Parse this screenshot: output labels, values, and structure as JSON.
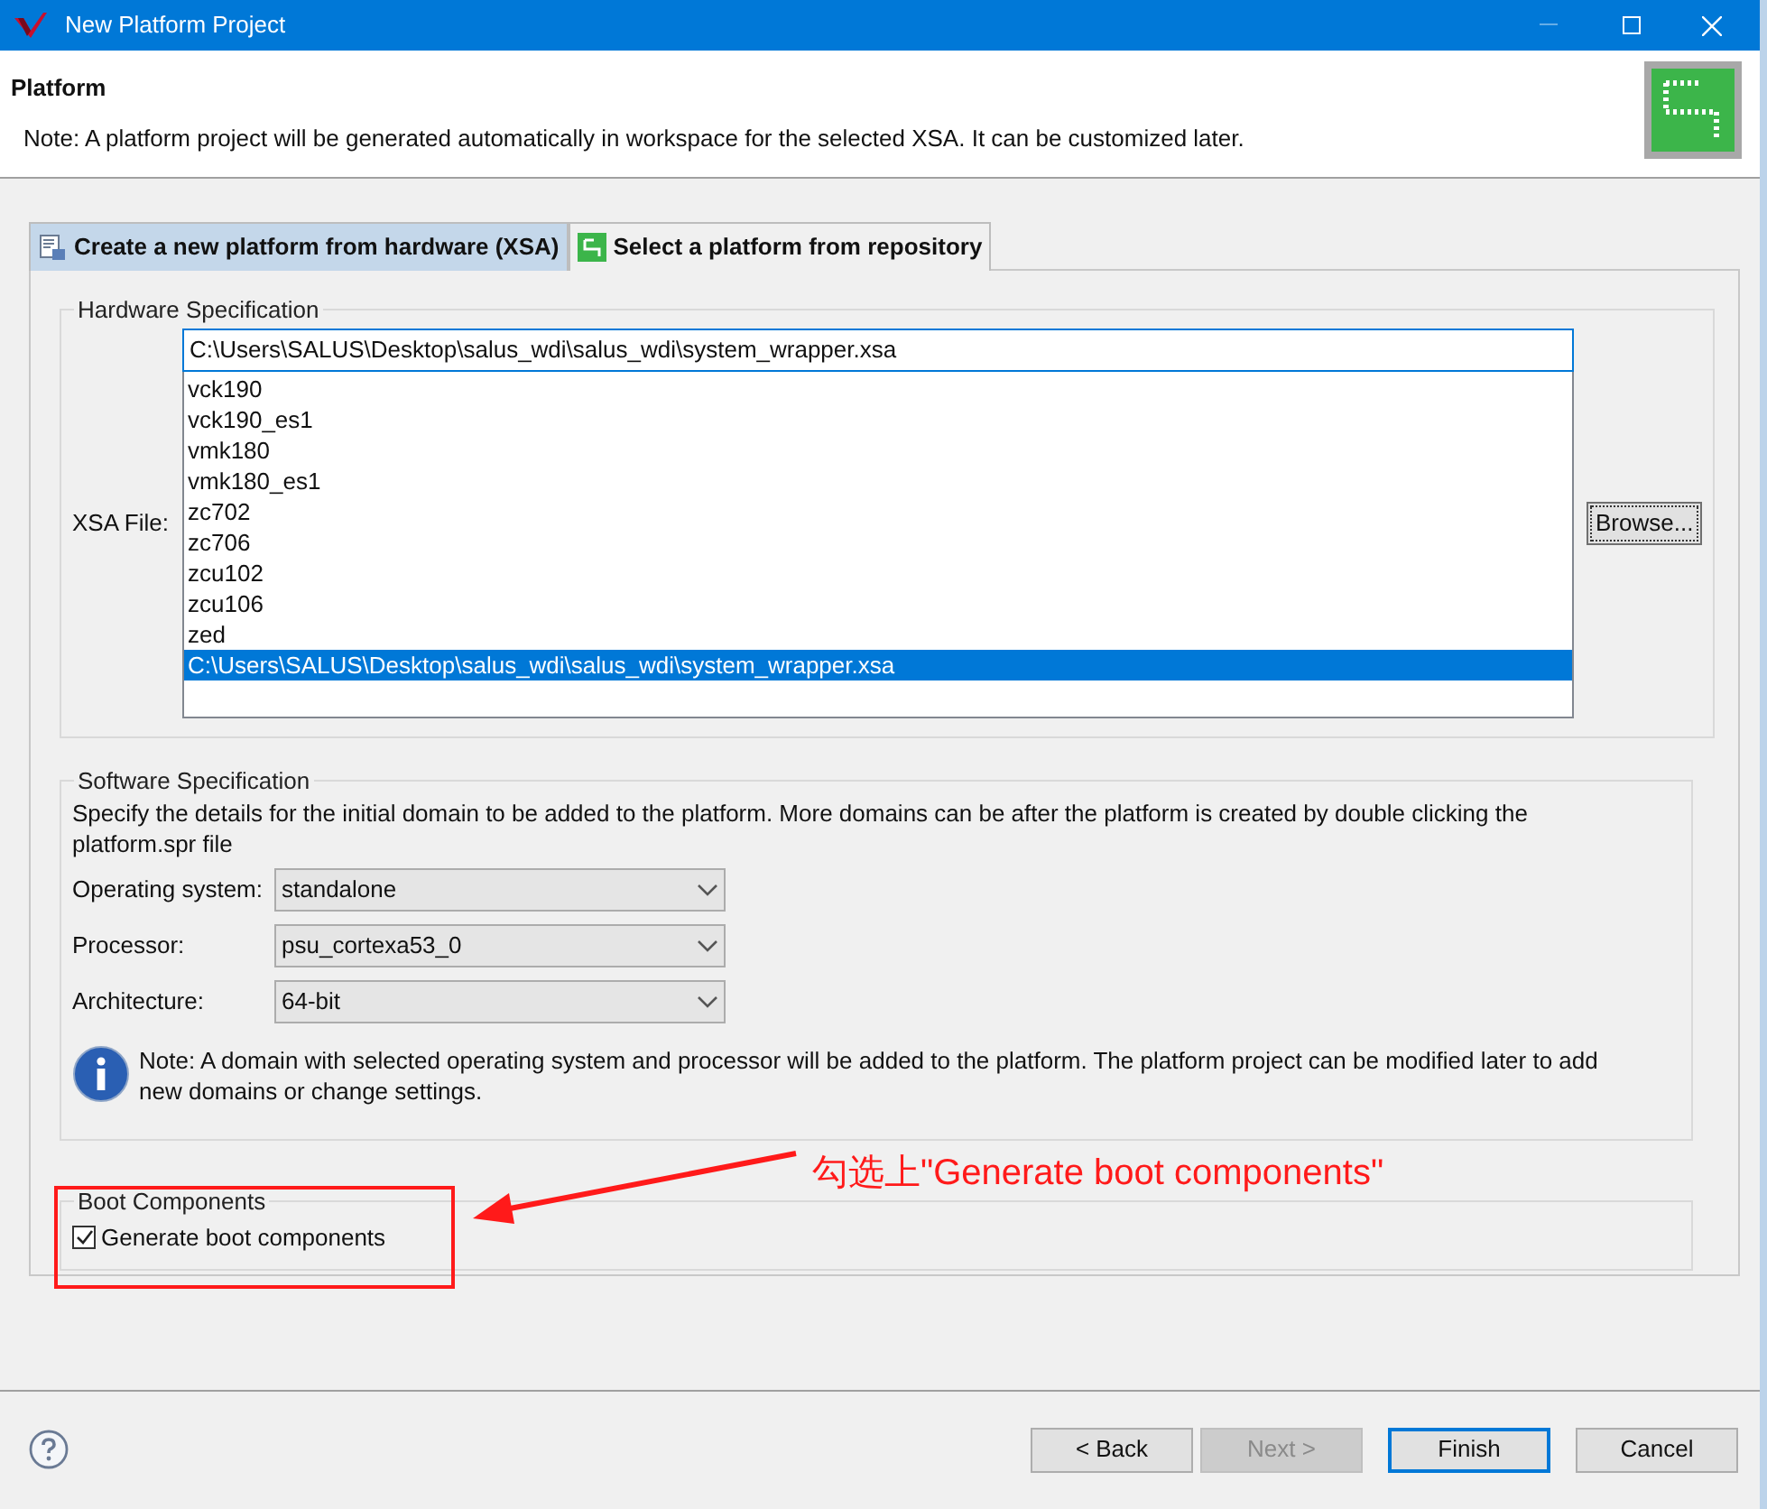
{
  "window": {
    "title": "New Platform Project"
  },
  "header": {
    "title": "Platform",
    "note": "Note: A platform project will be generated automatically in workspace for the selected XSA. It can be customized later."
  },
  "tabs": [
    {
      "label": "Create a new platform from hardware (XSA)",
      "selected": true
    },
    {
      "label": "Select a platform from repository",
      "selected": false
    }
  ],
  "hardware": {
    "title": "Hardware Specification",
    "label": "XSA File:",
    "value": "C:\\Users\\SALUS\\Desktop\\salus_wdi\\salus_wdi\\system_wrapper.xsa",
    "browse": "Browse...",
    "options": [
      {
        "label": "vck190",
        "selected": false
      },
      {
        "label": "vck190_es1",
        "selected": false
      },
      {
        "label": "vmk180",
        "selected": false
      },
      {
        "label": "vmk180_es1",
        "selected": false
      },
      {
        "label": "zc702",
        "selected": false
      },
      {
        "label": "zc706",
        "selected": false
      },
      {
        "label": "zcu102",
        "selected": false
      },
      {
        "label": "zcu106",
        "selected": false
      },
      {
        "label": "zed",
        "selected": false
      },
      {
        "label": "C:\\Users\\SALUS\\Desktop\\salus_wdi\\salus_wdi\\system_wrapper.xsa",
        "selected": true
      }
    ]
  },
  "software": {
    "title": "Software Specification",
    "description": "Specify the details for the initial domain to be added to the platform. More domains can be after the platform is created by double clicking the platform.spr file",
    "fields": [
      {
        "label": "Operating system:",
        "value": "standalone"
      },
      {
        "label": "Processor:",
        "value": "psu_cortexa53_0"
      },
      {
        "label": "Architecture:",
        "value": "64-bit"
      }
    ],
    "note": "Note: A domain with selected operating system and processor will be added to the platform. The platform project can be modified later to add new domains or change settings."
  },
  "boot": {
    "title": "Boot Components",
    "checkbox": {
      "label": "Generate boot components",
      "checked": true
    }
  },
  "annotation": {
    "text": "勾选上\"Generate boot components\""
  },
  "buttons": [
    {
      "label": "< Back",
      "disabled": false,
      "default": false
    },
    {
      "label": "Next >",
      "disabled": true,
      "default": false
    },
    {
      "label": "Finish",
      "disabled": false,
      "default": true
    },
    {
      "label": "Cancel",
      "disabled": false,
      "default": false
    }
  ]
}
